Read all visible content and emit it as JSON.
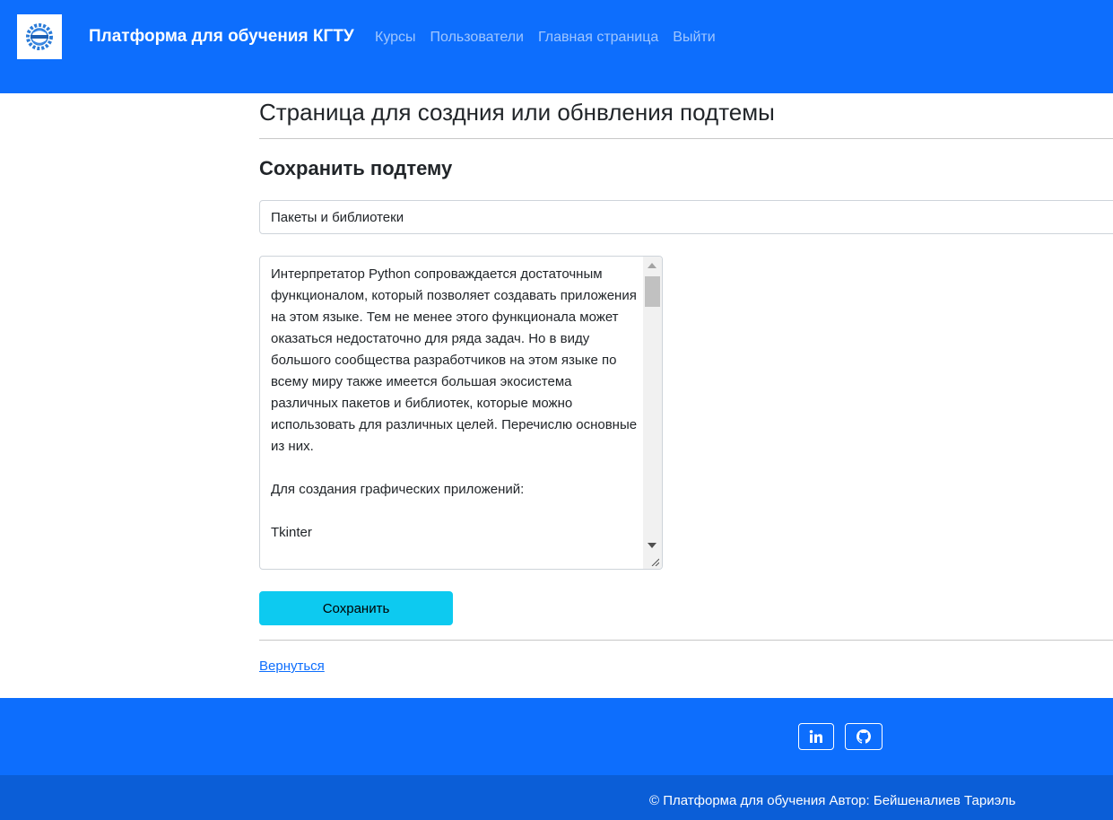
{
  "navbar": {
    "brand": "Платформа для обучения КГТУ",
    "links": [
      "Курсы",
      "Пользователи",
      "Главная страница",
      "Выйти"
    ]
  },
  "page": {
    "title": "Страница для создния или обнвления подтемы",
    "form_title": "Сохранить подтему",
    "title_value": "Пакеты и библиотеки",
    "content_value": "Интерпретатор Python сопроваждается достаточным функционалом, который позволяет создавать приложения на этом языке. Тем не менее этого функционала может оказаться недостаточно для ряда задач. Но в виду большого сообщества разработчиков на этом языке по всему миру также имеется большая экосистема различных пакетов и библиотек, которые можно использовать для различных целей. Перечислю основные из них.\n\nДля создания графических приложений:\n\nTkinter",
    "save_label": "Сохранить",
    "back_label": "Вернуться"
  },
  "footer": {
    "social_icons": [
      "linkedin-icon",
      "github-icon"
    ],
    "copyright": "© Платформа для обучения Автор: Бейшеналиев Тариэль"
  },
  "colors": {
    "primary": "#0d6efd",
    "footer_dark": "#0b5ed7",
    "button_info": "#0dcaf0"
  }
}
